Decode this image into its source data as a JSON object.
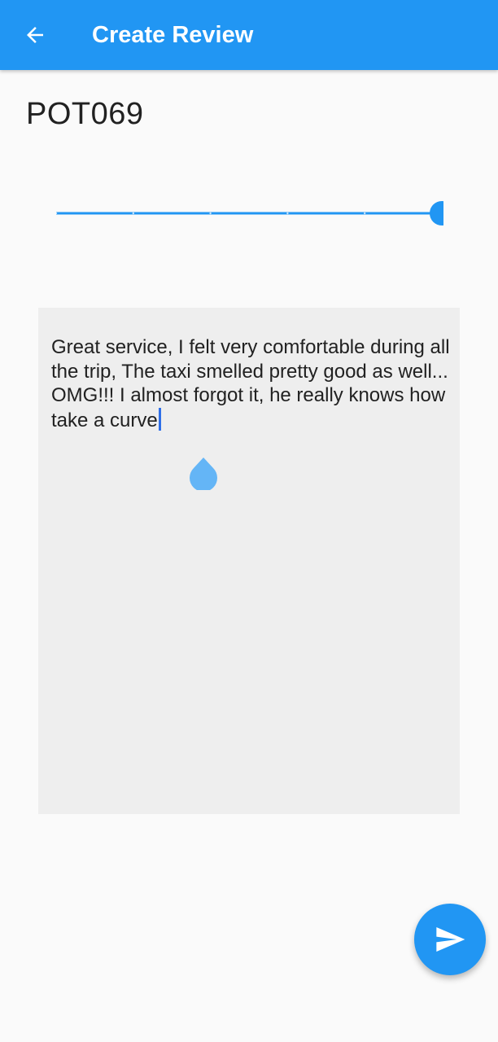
{
  "app_bar": {
    "title": "Create Review",
    "back_icon": "arrow-back-icon",
    "background_color": "#2196f3"
  },
  "content": {
    "code": "POT069"
  },
  "rating_slider": {
    "min": 0,
    "max": 5,
    "value": 5,
    "divisions": 5,
    "color": "#2196f3"
  },
  "review": {
    "text": "Great service, I felt very comfortable during all the trip, The taxi smelled pretty good as well...\nOMG!!! I almost forgot it, he really knows how take a curve"
  },
  "fab": {
    "icon": "send-icon",
    "color": "#2196f3"
  }
}
